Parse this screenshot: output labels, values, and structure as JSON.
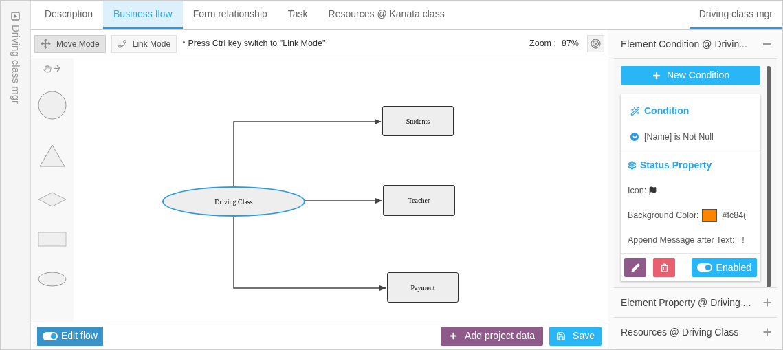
{
  "side_strip": {
    "title": "Driving class mgr"
  },
  "tabs": [
    {
      "label": "Description",
      "selected": false
    },
    {
      "label": "Business flow",
      "selected": true
    },
    {
      "label": "Form relationship",
      "selected": false
    },
    {
      "label": "Task",
      "selected": false
    },
    {
      "label": "Resources @ Kanata class",
      "selected": false
    }
  ],
  "right_tab": {
    "label": "Driving class mgr",
    "selected": true
  },
  "toolbar": {
    "modes": [
      {
        "label": "Move Mode",
        "selected": true
      },
      {
        "label": "Link Mode",
        "selected": false
      }
    ],
    "hint": "* Press Ctrl key switch to \"Link Mode\"",
    "zoom_label": "Zoom :",
    "zoom_value": "87%"
  },
  "palette": [
    {
      "kind": "circle"
    },
    {
      "kind": "triangle"
    },
    {
      "kind": "diamond"
    },
    {
      "kind": "rectangle"
    },
    {
      "kind": "ellipse"
    }
  ],
  "diagram": {
    "nodes": [
      {
        "label": "Driving Class",
        "kind": "ellipse",
        "selected": true
      },
      {
        "label": "Students",
        "kind": "rectangle",
        "selected": false
      },
      {
        "label": "Teacher",
        "kind": "rectangle",
        "selected": false
      },
      {
        "label": "Payment",
        "kind": "rectangle",
        "selected": false
      }
    ]
  },
  "footer": {
    "edit_flow": {
      "label": "Edit flow",
      "on": true
    },
    "add_project_data": "Add project data",
    "save": "Save"
  },
  "panel": {
    "sections": [
      {
        "title": "Element Condition @ Drivin...",
        "expanded": true
      },
      {
        "title": "Element Property @ Driving ...",
        "expanded": false
      },
      {
        "title": "Resources @ Driving Class",
        "expanded": false
      }
    ],
    "new_condition": "New Condition",
    "condition": {
      "heading": "Condition",
      "items": [
        "[Name] is Not Null"
      ]
    },
    "status": {
      "heading": "Status Property",
      "icon_label": "Icon:",
      "bg_label": "Background Color:",
      "color": "#fc8400",
      "color_text": "#fc84(",
      "append_label": "Append Message after Text: =!"
    },
    "enabled": {
      "label": "Enabled",
      "on": true
    }
  }
}
